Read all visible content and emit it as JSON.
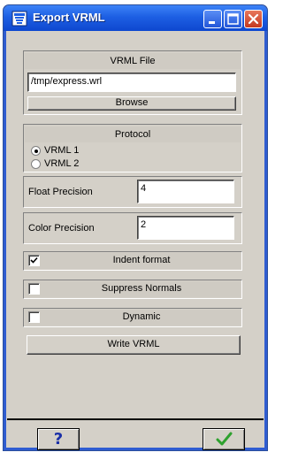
{
  "window": {
    "title": "Export VRML",
    "icons": {
      "app": "vrml-app-icon",
      "minimize": "minimize-icon",
      "maximize": "maximize-icon",
      "close": "close-icon"
    }
  },
  "vrml_file": {
    "label": "VRML File",
    "path_value": "/tmp/express.wrl",
    "browse_label": "Browse"
  },
  "protocol": {
    "label": "Protocol",
    "options": [
      {
        "label": "VRML 1",
        "selected": true
      },
      {
        "label": "VRML 2",
        "selected": false
      }
    ]
  },
  "float_precision": {
    "label": "Float Precision",
    "value": "4"
  },
  "color_precision": {
    "label": "Color Precision",
    "value": "2"
  },
  "toggles": [
    {
      "label": "Indent format",
      "checked": true
    },
    {
      "label": "Suppress Normals",
      "checked": false
    },
    {
      "label": "Dynamic",
      "checked": false
    }
  ],
  "write_label": "Write VRML",
  "footer": {
    "help_label": "?",
    "ok_icon": "green-checkmark-icon",
    "help_color": "#1a2fa8",
    "ok_color": "#2ea12e"
  }
}
